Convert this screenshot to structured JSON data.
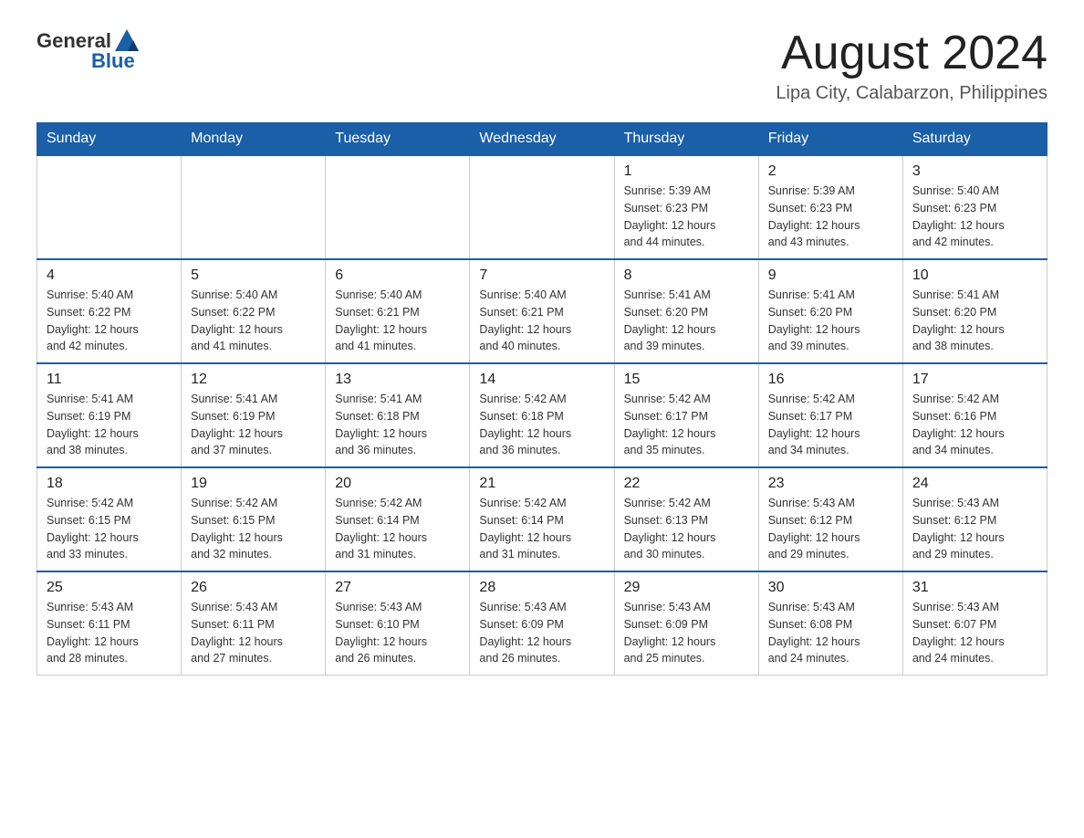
{
  "header": {
    "logo_general": "General",
    "logo_blue": "Blue",
    "month_title": "August 2024",
    "location": "Lipa City, Calabarzon, Philippines"
  },
  "weekdays": [
    "Sunday",
    "Monday",
    "Tuesday",
    "Wednesday",
    "Thursday",
    "Friday",
    "Saturday"
  ],
  "weeks": [
    [
      {
        "day": "",
        "info": ""
      },
      {
        "day": "",
        "info": ""
      },
      {
        "day": "",
        "info": ""
      },
      {
        "day": "",
        "info": ""
      },
      {
        "day": "1",
        "info": "Sunrise: 5:39 AM\nSunset: 6:23 PM\nDaylight: 12 hours\nand 44 minutes."
      },
      {
        "day": "2",
        "info": "Sunrise: 5:39 AM\nSunset: 6:23 PM\nDaylight: 12 hours\nand 43 minutes."
      },
      {
        "day": "3",
        "info": "Sunrise: 5:40 AM\nSunset: 6:23 PM\nDaylight: 12 hours\nand 42 minutes."
      }
    ],
    [
      {
        "day": "4",
        "info": "Sunrise: 5:40 AM\nSunset: 6:22 PM\nDaylight: 12 hours\nand 42 minutes."
      },
      {
        "day": "5",
        "info": "Sunrise: 5:40 AM\nSunset: 6:22 PM\nDaylight: 12 hours\nand 41 minutes."
      },
      {
        "day": "6",
        "info": "Sunrise: 5:40 AM\nSunset: 6:21 PM\nDaylight: 12 hours\nand 41 minutes."
      },
      {
        "day": "7",
        "info": "Sunrise: 5:40 AM\nSunset: 6:21 PM\nDaylight: 12 hours\nand 40 minutes."
      },
      {
        "day": "8",
        "info": "Sunrise: 5:41 AM\nSunset: 6:20 PM\nDaylight: 12 hours\nand 39 minutes."
      },
      {
        "day": "9",
        "info": "Sunrise: 5:41 AM\nSunset: 6:20 PM\nDaylight: 12 hours\nand 39 minutes."
      },
      {
        "day": "10",
        "info": "Sunrise: 5:41 AM\nSunset: 6:20 PM\nDaylight: 12 hours\nand 38 minutes."
      }
    ],
    [
      {
        "day": "11",
        "info": "Sunrise: 5:41 AM\nSunset: 6:19 PM\nDaylight: 12 hours\nand 38 minutes."
      },
      {
        "day": "12",
        "info": "Sunrise: 5:41 AM\nSunset: 6:19 PM\nDaylight: 12 hours\nand 37 minutes."
      },
      {
        "day": "13",
        "info": "Sunrise: 5:41 AM\nSunset: 6:18 PM\nDaylight: 12 hours\nand 36 minutes."
      },
      {
        "day": "14",
        "info": "Sunrise: 5:42 AM\nSunset: 6:18 PM\nDaylight: 12 hours\nand 36 minutes."
      },
      {
        "day": "15",
        "info": "Sunrise: 5:42 AM\nSunset: 6:17 PM\nDaylight: 12 hours\nand 35 minutes."
      },
      {
        "day": "16",
        "info": "Sunrise: 5:42 AM\nSunset: 6:17 PM\nDaylight: 12 hours\nand 34 minutes."
      },
      {
        "day": "17",
        "info": "Sunrise: 5:42 AM\nSunset: 6:16 PM\nDaylight: 12 hours\nand 34 minutes."
      }
    ],
    [
      {
        "day": "18",
        "info": "Sunrise: 5:42 AM\nSunset: 6:15 PM\nDaylight: 12 hours\nand 33 minutes."
      },
      {
        "day": "19",
        "info": "Sunrise: 5:42 AM\nSunset: 6:15 PM\nDaylight: 12 hours\nand 32 minutes."
      },
      {
        "day": "20",
        "info": "Sunrise: 5:42 AM\nSunset: 6:14 PM\nDaylight: 12 hours\nand 31 minutes."
      },
      {
        "day": "21",
        "info": "Sunrise: 5:42 AM\nSunset: 6:14 PM\nDaylight: 12 hours\nand 31 minutes."
      },
      {
        "day": "22",
        "info": "Sunrise: 5:42 AM\nSunset: 6:13 PM\nDaylight: 12 hours\nand 30 minutes."
      },
      {
        "day": "23",
        "info": "Sunrise: 5:43 AM\nSunset: 6:12 PM\nDaylight: 12 hours\nand 29 minutes."
      },
      {
        "day": "24",
        "info": "Sunrise: 5:43 AM\nSunset: 6:12 PM\nDaylight: 12 hours\nand 29 minutes."
      }
    ],
    [
      {
        "day": "25",
        "info": "Sunrise: 5:43 AM\nSunset: 6:11 PM\nDaylight: 12 hours\nand 28 minutes."
      },
      {
        "day": "26",
        "info": "Sunrise: 5:43 AM\nSunset: 6:11 PM\nDaylight: 12 hours\nand 27 minutes."
      },
      {
        "day": "27",
        "info": "Sunrise: 5:43 AM\nSunset: 6:10 PM\nDaylight: 12 hours\nand 26 minutes."
      },
      {
        "day": "28",
        "info": "Sunrise: 5:43 AM\nSunset: 6:09 PM\nDaylight: 12 hours\nand 26 minutes."
      },
      {
        "day": "29",
        "info": "Sunrise: 5:43 AM\nSunset: 6:09 PM\nDaylight: 12 hours\nand 25 minutes."
      },
      {
        "day": "30",
        "info": "Sunrise: 5:43 AM\nSunset: 6:08 PM\nDaylight: 12 hours\nand 24 minutes."
      },
      {
        "day": "31",
        "info": "Sunrise: 5:43 AM\nSunset: 6:07 PM\nDaylight: 12 hours\nand 24 minutes."
      }
    ]
  ]
}
